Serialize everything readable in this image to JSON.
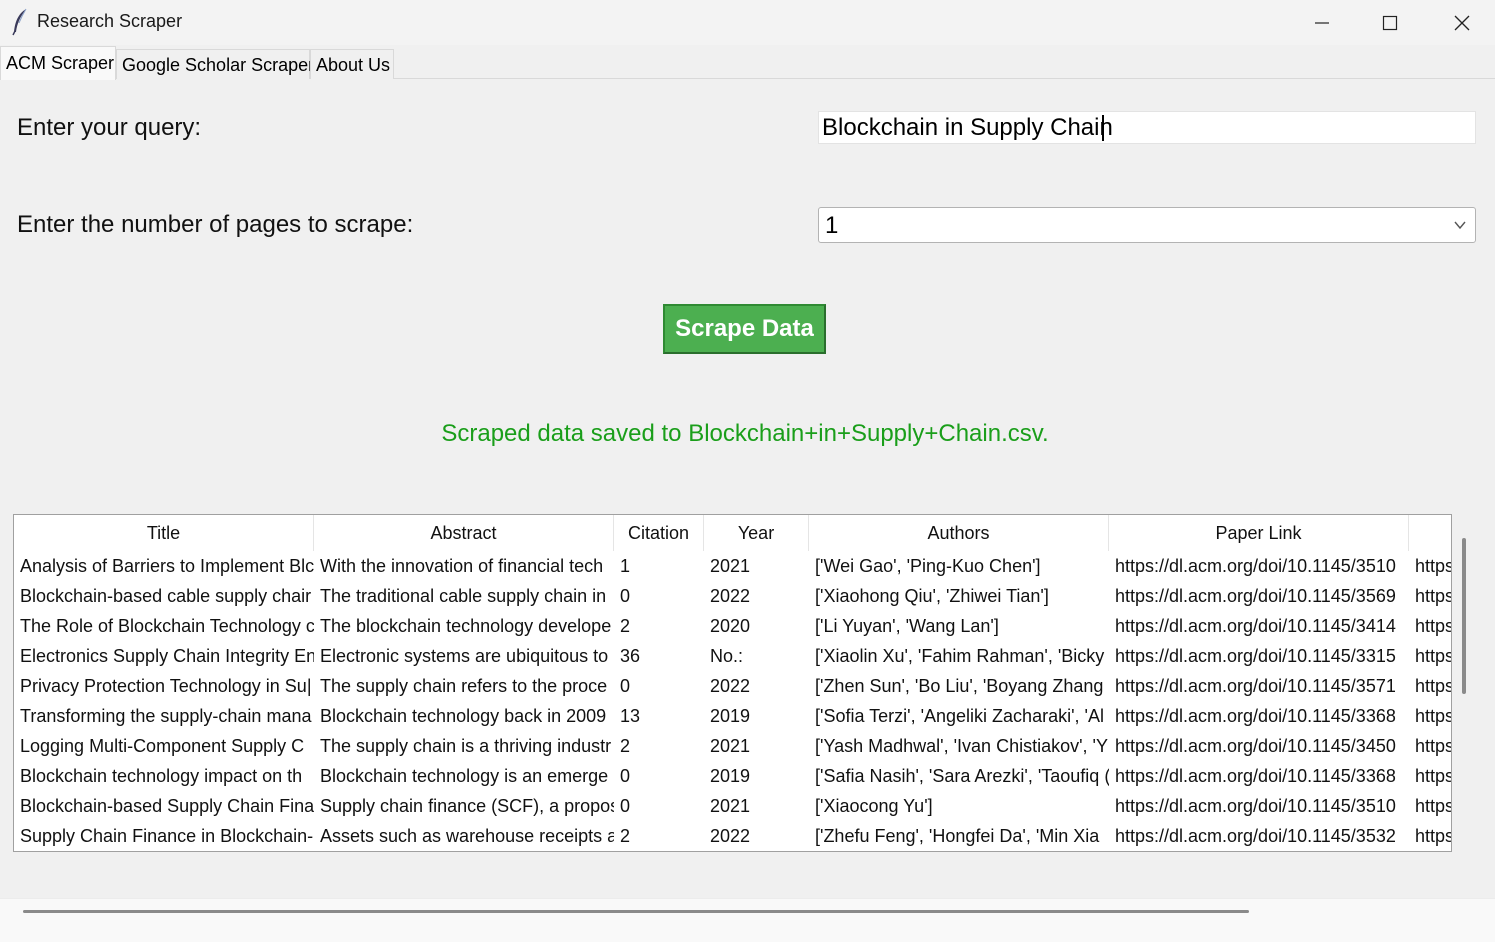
{
  "window": {
    "title": "Research Scraper",
    "icon": "feather-icon",
    "controls": [
      "minimize-icon",
      "maximize-icon",
      "close-icon"
    ]
  },
  "tabs": [
    {
      "label": "ACM Scraper",
      "active": true
    },
    {
      "label": "Google Scholar Scraper",
      "active": false
    },
    {
      "label": "About Us",
      "active": false
    }
  ],
  "form": {
    "query_label": "Enter your query:",
    "query_value": "Blockchain in Supply Chain",
    "pages_label": "Enter the number of pages to scrape:",
    "pages_value": "1",
    "scrape_button": "Scrape Data"
  },
  "status": {
    "message": "Scraped data saved to Blockchain+in+Supply+Chain.csv.",
    "color": "#1a9e1a"
  },
  "colors": {
    "button_bg": "#4caf50",
    "button_text": "#ffffff"
  },
  "table": {
    "columns": [
      "Title",
      "Abstract",
      "Citation",
      "Year",
      "Authors",
      "Paper Link",
      ""
    ],
    "rows": [
      [
        "Analysis of Barriers to Implement Blc",
        "With the innovation of financial tech",
        "1",
        "2021",
        "['Wei Gao', 'Ping-Kuo Chen']",
        "https://dl.acm.org/doi/10.1145/3510",
        "https:"
      ],
      [
        "Blockchain-based cable supply chair",
        "The traditional cable supply chain in",
        "0",
        "2022",
        "['Xiaohong Qiu', 'Zhiwei Tian']",
        "https://dl.acm.org/doi/10.1145/3569",
        "https:"
      ],
      [
        "The Role of Blockchain Technology c",
        "The blockchain technology develope",
        "2",
        "2020",
        "['Li Yuyan', 'Wang Lan']",
        "https://dl.acm.org/doi/10.1145/3414",
        "https:"
      ],
      [
        "Electronics Supply Chain Integrity En",
        "Electronic systems are ubiquitous to",
        "36",
        "No.:",
        "['Xiaolin Xu', 'Fahim Rahman', 'Bicky",
        "https://dl.acm.org/doi/10.1145/3315",
        "https:"
      ],
      [
        "Privacy Protection Technology in Su|",
        " The supply chain refers to the proce",
        "0",
        "2022",
        "['Zhen Sun', 'Bo Liu', 'Boyang Zhang",
        "https://dl.acm.org/doi/10.1145/3571",
        "https:"
      ],
      [
        "Transforming the supply-chain mana",
        "Blockchain technology back in 2009",
        "13",
        "2019",
        "['Sofia Terzi', 'Angeliki Zacharaki', 'Al",
        "https://dl.acm.org/doi/10.1145/3368",
        "https:"
      ],
      [
        "Logging Multi-Component Supply C",
        "The supply chain is a thriving industr",
        "2",
        "2021",
        "['Yash Madhwal', 'Ivan Chistiakov', 'Y",
        "https://dl.acm.org/doi/10.1145/3450",
        "https:"
      ],
      [
        "Blockchain technology impact on th",
        "Blockchain technology is an emerge",
        "0",
        "2019",
        "['Safia Nasih', 'Sara Arezki', 'Taoufiq (",
        "https://dl.acm.org/doi/10.1145/3368",
        "https:"
      ],
      [
        "Blockchain-based Supply Chain Fina",
        "Supply chain finance (SCF), a propos",
        "0",
        "2021",
        "['Xiaocong Yu']",
        "https://dl.acm.org/doi/10.1145/3510",
        "https:"
      ],
      [
        "Supply Chain Finance in Blockchain-",
        "Assets such as warehouse receipts ar",
        "2",
        "2022",
        "['Zhefu Feng', 'Hongfei Da', 'Min Xia",
        "https://dl.acm.org/doi/10.1145/3532",
        "https:"
      ]
    ]
  }
}
